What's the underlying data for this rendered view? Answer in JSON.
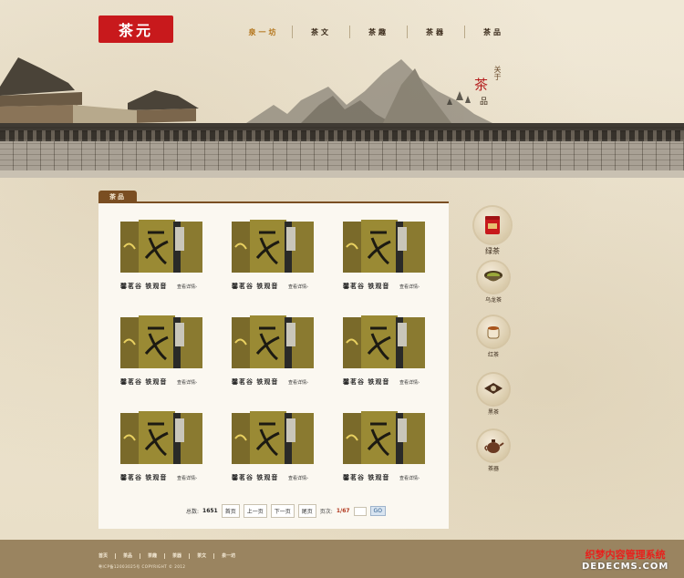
{
  "header": {
    "logo_text": "茶元",
    "nav": [
      "泉一坊",
      "茶文",
      "茶趣",
      "茶器",
      "茶品"
    ],
    "active_index": 0,
    "about": {
      "small": "关于",
      "big": "茶",
      "bottom": "品"
    }
  },
  "main": {
    "section_tab": "茶品",
    "products": [
      {
        "name": "馨茗谷 铁观音",
        "more": "查看详情›"
      },
      {
        "name": "馨茗谷 铁观音",
        "more": "查看详情›"
      },
      {
        "name": "馨茗谷 铁观音",
        "more": "查看详情›"
      },
      {
        "name": "馨茗谷 铁观音",
        "more": "查看详情›"
      },
      {
        "name": "馨茗谷 铁观音",
        "more": "查看详情›"
      },
      {
        "name": "馨茗谷 铁观音",
        "more": "查看详情›"
      },
      {
        "name": "馨茗谷 铁观音",
        "more": "查看详情›"
      },
      {
        "name": "馨茗谷 铁观音",
        "more": "查看详情›"
      },
      {
        "name": "馨茗谷 铁观音",
        "more": "查看详情›"
      }
    ],
    "pager": {
      "total_label": "总数:",
      "total_value": "1651",
      "first": "首页",
      "prev": "上一页",
      "next": "下一页",
      "last": "尾页",
      "page_label": "页次:",
      "page_value": "1/67",
      "go": "GO"
    }
  },
  "sidebar": {
    "categories": [
      {
        "label": "绿茶",
        "icon": "tea-can-icon"
      },
      {
        "label": "乌龙茶",
        "icon": "tea-cup-green-icon"
      },
      {
        "label": "红茶",
        "icon": "tea-cup-red-icon"
      },
      {
        "label": "黑茶",
        "icon": "tea-brick-icon"
      },
      {
        "label": "茶器",
        "icon": "teapot-icon"
      }
    ]
  },
  "footer": {
    "links": [
      "首页",
      "茶品",
      "茶趣",
      "茶器",
      "茶文",
      "泉一坊"
    ],
    "copyright": "粤ICP备12003025号 COPYRIGHT © 2012"
  },
  "watermark": {
    "line1": "织梦内容管理系统",
    "line2": "DEDECMS.COM"
  },
  "colors": {
    "accent_red": "#c8191c",
    "brown": "#7a4e22",
    "footer": "#9a8460",
    "nav_active": "#b3741a"
  }
}
